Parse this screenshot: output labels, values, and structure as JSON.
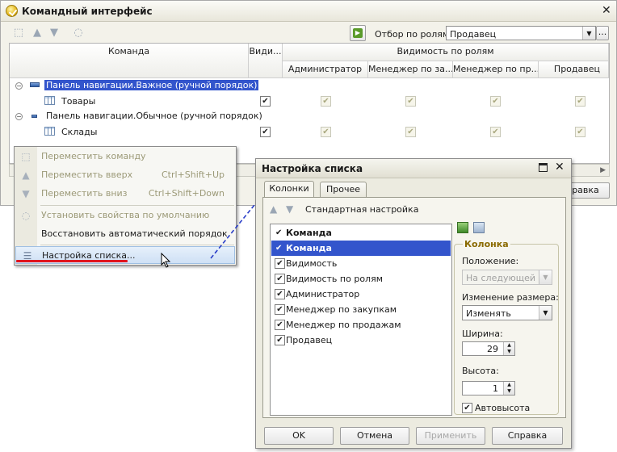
{
  "main": {
    "title": "Командный интерфейс",
    "filter_label": "Отбор по ролям:",
    "filter_value": "Продавец",
    "filter_more": "...",
    "columns": {
      "command": "Команда",
      "visibility": "Види...",
      "role_visibility": "Видимость по ролям",
      "roles": [
        "Администратор",
        "Менеджер по за...",
        "Менеджер по пр...",
        "Продавец"
      ]
    },
    "rows": [
      {
        "label": "Панель навигации.Важное (ручной порядок)",
        "type": "group",
        "selected": true
      },
      {
        "label": "Товары",
        "type": "item",
        "visible": true,
        "roles": [
          true,
          true,
          true,
          true
        ]
      },
      {
        "label": "Панель навигации.Обычное (ручной порядок)",
        "type": "group",
        "selected": false
      },
      {
        "label": "Склады",
        "type": "item",
        "visible": true,
        "roles": [
          true,
          true,
          true,
          true
        ]
      }
    ],
    "help_button_partial": "равка"
  },
  "context_menu": {
    "items": [
      {
        "label": "Переместить команду",
        "shortcut": "",
        "disabled": true,
        "icon": "move-icon"
      },
      {
        "label": "Переместить вверх",
        "shortcut": "Ctrl+Shift+Up",
        "disabled": true,
        "icon": "arrow-up-icon"
      },
      {
        "label": "Переместить вниз",
        "shortcut": "Ctrl+Shift+Down",
        "disabled": true,
        "icon": "arrow-down-icon"
      },
      {
        "label": "Установить свойства по умолчанию",
        "shortcut": "",
        "disabled": true,
        "icon": "reset-icon"
      },
      {
        "label": "Восстановить автоматический порядок",
        "shortcut": "",
        "disabled": false,
        "icon": ""
      },
      {
        "label": "Настройка списка...",
        "shortcut": "",
        "disabled": false,
        "icon": "list-settings-icon"
      }
    ]
  },
  "dialog": {
    "title": "Настройка списка",
    "tabs": [
      "Колонки",
      "Прочее"
    ],
    "toolbar_label": "Стандартная настройка",
    "columns_list": [
      {
        "label": "Команда",
        "mark": "tick",
        "bold": true,
        "selected": false
      },
      {
        "label": "Команда",
        "mark": "tick",
        "bold": true,
        "selected": true
      },
      {
        "label": "Видимость",
        "mark": "checkbox",
        "bold": false,
        "selected": false
      },
      {
        "label": "Видимость по ролям",
        "mark": "checkbox",
        "bold": false,
        "selected": false
      },
      {
        "label": "Администратор",
        "mark": "checkbox",
        "bold": false,
        "selected": false
      },
      {
        "label": "Менеджер по закупкам",
        "mark": "checkbox",
        "bold": false,
        "selected": false
      },
      {
        "label": "Менеджер по продажам",
        "mark": "checkbox",
        "bold": false,
        "selected": false
      },
      {
        "label": "Продавец",
        "mark": "checkbox",
        "bold": false,
        "selected": false
      }
    ],
    "column_group": {
      "title": "Колонка",
      "position_label": "Положение:",
      "position_value": "На следующей стр",
      "resize_label": "Изменение размера:",
      "resize_value": "Изменять",
      "width_label": "Ширина:",
      "width_value": "29",
      "height_label": "Высота:",
      "height_value": "1",
      "autoheight_label": "Автовысота",
      "autoheight_checked": true
    },
    "buttons": {
      "ok": "OK",
      "cancel": "Отмена",
      "apply": "Применить",
      "help": "Справка"
    }
  },
  "colors": {
    "selection": "#3355cc",
    "highlight_underline": "#e0141e",
    "arrow": "#2a3ec8"
  }
}
